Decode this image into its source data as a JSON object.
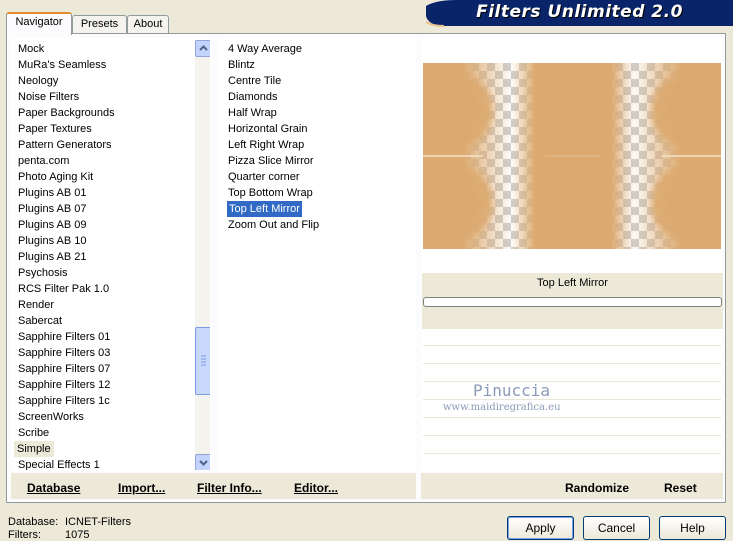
{
  "tabs": [
    {
      "label": "Navigator",
      "active": true
    },
    {
      "label": "Presets",
      "active": false
    },
    {
      "label": "About",
      "active": false
    }
  ],
  "banner": {
    "title": "Filters Unlimited 2.0",
    "color": "#0a246a"
  },
  "categories": {
    "items": [
      "Mock",
      "MuRa's Seamless",
      "Neology",
      "Noise Filters",
      "Paper Backgrounds",
      "Paper Textures",
      "Pattern Generators",
      "penta.com",
      "Photo Aging Kit",
      "Plugins AB 01",
      "Plugins AB 07",
      "Plugins AB 09",
      "Plugins AB 10",
      "Plugins AB 21",
      "Psychosis",
      "RCS Filter Pak 1.0",
      "Render",
      "Sabercat",
      "Sapphire Filters 01",
      "Sapphire Filters 03",
      "Sapphire Filters 07",
      "Sapphire Filters 12",
      "Sapphire Filters 1c",
      "ScreenWorks",
      "Scribe",
      "Simple",
      "Special Effects 1"
    ],
    "selected": "Simple"
  },
  "filters": {
    "items": [
      "4 Way Average",
      "Blintz",
      "Centre Tile",
      "Diamonds",
      "Half Wrap",
      "Horizontal Grain",
      "Left Right Wrap",
      "Pizza Slice Mirror",
      "Quarter corner",
      "Top Bottom Wrap",
      "Top Left Mirror",
      "Zoom Out and Flip"
    ],
    "selected": "Top Left Mirror"
  },
  "preview": {
    "filter_name": "Top Left Mirror",
    "watermark_name": "Pinuccia",
    "watermark_url": "www.maidiregrafica.eu",
    "tan_color": "#dcaa70"
  },
  "toolbar": {
    "database": "Database",
    "import": "Import...",
    "filter_info": "Filter Info...",
    "editor": "Editor...",
    "randomize": "Randomize",
    "reset": "Reset"
  },
  "status": {
    "database_label": "Database:",
    "database_value": "ICNET-Filters",
    "filters_label": "Filters:",
    "filters_value": "1075"
  },
  "buttons": {
    "apply": "Apply",
    "cancel": "Cancel",
    "help": "Help"
  }
}
